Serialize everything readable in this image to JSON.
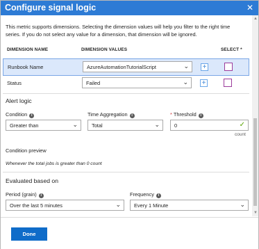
{
  "header": {
    "title": "Configure signal logic",
    "close_glyph": "✕"
  },
  "intro_text": "This metric supports dimensions. Selecting the dimension values will help you filter to the right time series. If you do not select any value for a dimension, that dimension will be ignored.",
  "dimension_table": {
    "columns": [
      "DIMENSION NAME",
      "DIMENSION VALUES",
      "SELECT *"
    ],
    "rows": [
      {
        "name": "Runbook Name",
        "value": "AzureAutomationTutorialScript"
      },
      {
        "name": "Status",
        "value": "Failed"
      }
    ]
  },
  "alert_logic": {
    "heading": "Alert logic",
    "condition": {
      "label": "Condition",
      "value": "Greater than"
    },
    "time_aggregation": {
      "label": "Time Aggregation",
      "value": "Total"
    },
    "threshold": {
      "label": "Threshold",
      "required_mark": "*",
      "value": "0",
      "unit": "count"
    }
  },
  "condition_preview": {
    "heading": "Condition preview",
    "text": "Whenever the total jobs is greater than 0 count"
  },
  "evaluated": {
    "heading": "Evaluated based on",
    "period": {
      "label": "Period (grain)",
      "value": "Over the last 5 minutes"
    },
    "frequency": {
      "label": "Frequency",
      "value": "Every 1 Minute"
    }
  },
  "footer": {
    "done_label": "Done"
  },
  "icons": {
    "chevron": "⌄",
    "plus": "+",
    "info": "i",
    "check": "✓"
  },
  "colors": {
    "header": "#2d7bd5",
    "primary_button": "#0f6cc9",
    "checkbox_border": "#9b3b9b",
    "selected_row": "#dbe8fb"
  }
}
